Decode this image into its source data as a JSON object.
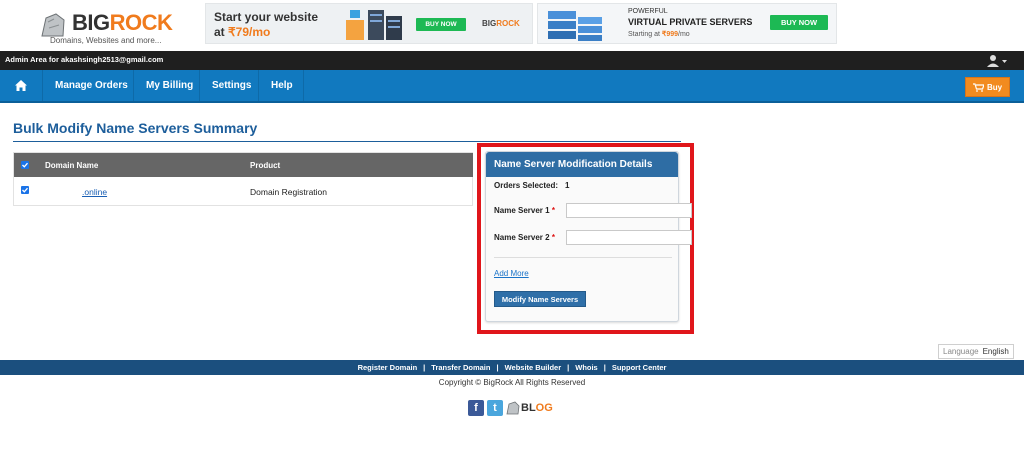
{
  "brand": {
    "logo_text_a": "BIG",
    "logo_text_b": "ROCK",
    "tagline": "Domains, Websites and more..."
  },
  "banners": {
    "website": {
      "title": "Start your website",
      "price_prefix": "at ",
      "price": "₹79/mo",
      "buy_label": "BUY NOW",
      "brand_a": "BIG",
      "brand_b": "ROCK"
    },
    "vps": {
      "line1": "POWERFUL",
      "line2": "VIRTUAL PRIVATE SERVERS",
      "line3_prefix": "Starting at ",
      "line3_price": "₹999",
      "line3_suffix": "/mo",
      "buy_label": "BUY NOW"
    }
  },
  "admin_bar": {
    "text": "Admin Area for akashsingh2513@gmail.com"
  },
  "nav": {
    "items": [
      {
        "label": "Manage Orders"
      },
      {
        "label": "My Billing"
      },
      {
        "label": "Settings"
      },
      {
        "label": "Help"
      }
    ],
    "buy_label": "Buy"
  },
  "page": {
    "title": "Bulk Modify Name Servers Summary"
  },
  "table": {
    "columns": [
      "Domain Name",
      "Product"
    ],
    "rows": [
      {
        "domain": ".online",
        "product": "Domain Registration",
        "checked": true
      }
    ]
  },
  "panel": {
    "title": "Name Server Modification Details",
    "orders_selected_label": "Orders Selected:",
    "orders_selected_value": "1",
    "ns1_label": "Name Server 1",
    "ns2_label": "Name Server 2",
    "required_mark": "*",
    "ns1_value": "",
    "ns2_value": "",
    "add_more": "Add More",
    "submit_label": "Modify Name Servers"
  },
  "language": {
    "label": "Language",
    "value": "English"
  },
  "footer": {
    "links": [
      "Register Domain",
      "Transfer Domain",
      "Website Builder",
      "Whois",
      "Support Center"
    ],
    "separator": "|",
    "copyright": "Copyright © BigRock All Rights Reserved",
    "blog_a": "BL",
    "blog_b": "OG"
  },
  "colors": {
    "nav_blue": "#1179bf",
    "brand_orange": "#f07b1d",
    "panel_header": "#2e6da4",
    "highlight_red": "#e0161b",
    "footer_blue": "#1b4f7e",
    "buy_green": "#1db954"
  }
}
